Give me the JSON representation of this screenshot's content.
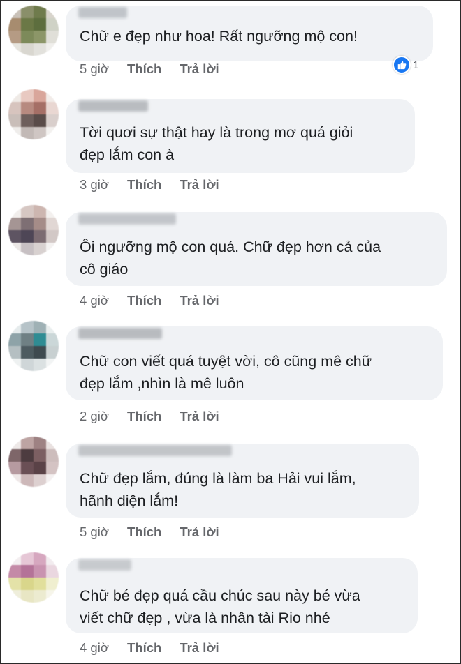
{
  "comments": [
    {
      "text_lines": [
        "Chữ e đẹp như hoa! Rất ngưỡng mộ con!"
      ],
      "time": "5 giờ",
      "like_label": "Thích",
      "reply_label": "Trả lời",
      "reaction": {
        "icon": "like-icon",
        "count": "1"
      },
      "avatar_colors": [
        "#c9c1b8",
        "#8a8f6a",
        "#6f7b4c",
        "#d8d4cc",
        "#a78c6f",
        "#6b7846",
        "#5d6e3e",
        "#cfd2c6",
        "#b59b84",
        "#7d8a5a",
        "#8c9668",
        "#e0dfd8",
        "#e6e4de",
        "#d9d7d0",
        "#e2e1dc",
        "#f0efec"
      ],
      "name_color": "#9aa0a6"
    },
    {
      "text_lines": [
        "Tời quơi sự thật hay là trong mơ quá giỏi",
        "đẹp lắm con à"
      ],
      "time": "3 giờ",
      "like_label": "Thích",
      "reply_label": "Trả lời",
      "avatar_colors": [
        "#efeae6",
        "#e8c9c1",
        "#d9a69b",
        "#f2ece9",
        "#d7c4be",
        "#b78a80",
        "#a56f66",
        "#e9d7d2",
        "#c9beb9",
        "#6e5f5c",
        "#5a4c49",
        "#d9cfcc",
        "#efedeb",
        "#c2b9b6",
        "#cfc6c3",
        "#f3f1ef"
      ],
      "name_color": "#8d9196"
    },
    {
      "text_lines": [
        "Ôi ngưỡng mộ con quá. Chữ đẹp hơn cả của",
        "cô giáo"
      ],
      "time": "4 giờ",
      "like_label": "Thích",
      "reply_label": "Trả lời",
      "avatar_colors": [
        "#f1eeec",
        "#d6c7c3",
        "#cdb6b0",
        "#f3f0ee",
        "#a59594",
        "#7e6f74",
        "#a58c88",
        "#e1d7d4",
        "#5e5462",
        "#4e4656",
        "#7c6c72",
        "#d2c8c6",
        "#ebe7e6",
        "#c7c0c3",
        "#d8d1d0",
        "#f4f2f1"
      ],
      "name_color": "#9ea2a7"
    },
    {
      "text_lines": [
        "Chữ con viết quá tuyệt vời, cô cũng mê chữ",
        "đẹp lắm ,nhìn là mê luôn"
      ],
      "time": "2 giờ",
      "like_label": "Thích",
      "reply_label": "Trả lời",
      "avatar_colors": [
        "#e5ebec",
        "#b6c3c8",
        "#9fb1b5",
        "#e9eeee",
        "#8ea3a8",
        "#6f8084",
        "#2f8c93",
        "#cbd7d8",
        "#b5bfc2",
        "#4d5b60",
        "#3e4a4f",
        "#c8d0d1",
        "#eef1f1",
        "#cfd6d8",
        "#dbe1e2",
        "#f2f4f4"
      ],
      "name_color": "#8b8f94"
    },
    {
      "text_lines": [
        "Chữ đẹp lắm, đúng là làm ba Hải vui lắm,",
        "hãnh diện lắm!"
      ],
      "time": "5 giờ",
      "like_label": "Thích",
      "reply_label": "Trả lời",
      "avatar_colors": [
        "#eee9e8",
        "#bda4a3",
        "#9e8283",
        "#e9e1e0",
        "#7e6669",
        "#4d3c40",
        "#7c5f62",
        "#cdbdbc",
        "#b69aa0",
        "#6a4f55",
        "#5a4247",
        "#d4c3c3",
        "#efe8e8",
        "#cdb8b9",
        "#ddd0d0",
        "#f4f0f0"
      ],
      "name_color": "#9da1a5"
    },
    {
      "text_lines": [
        "Chữ bé đẹp quá cầu chúc sau này bé vừa",
        "viết chữ đẹp , vừa là nhân tài Rio nhé"
      ],
      "time": "4 giờ",
      "like_label": "Thích",
      "reply_label": "Trả lời",
      "avatar_colors": [
        "#f3eef0",
        "#e6c7d6",
        "#d6a7bf",
        "#f2ecef",
        "#c48aa7",
        "#b47398",
        "#c993b0",
        "#ead7e0",
        "#e4e2a8",
        "#d9d68b",
        "#e1df9c",
        "#f0efd0",
        "#efeedb",
        "#e8e6c4",
        "#ecebd0",
        "#f6f5ea"
      ],
      "name_color": "#a7abaf"
    }
  ]
}
